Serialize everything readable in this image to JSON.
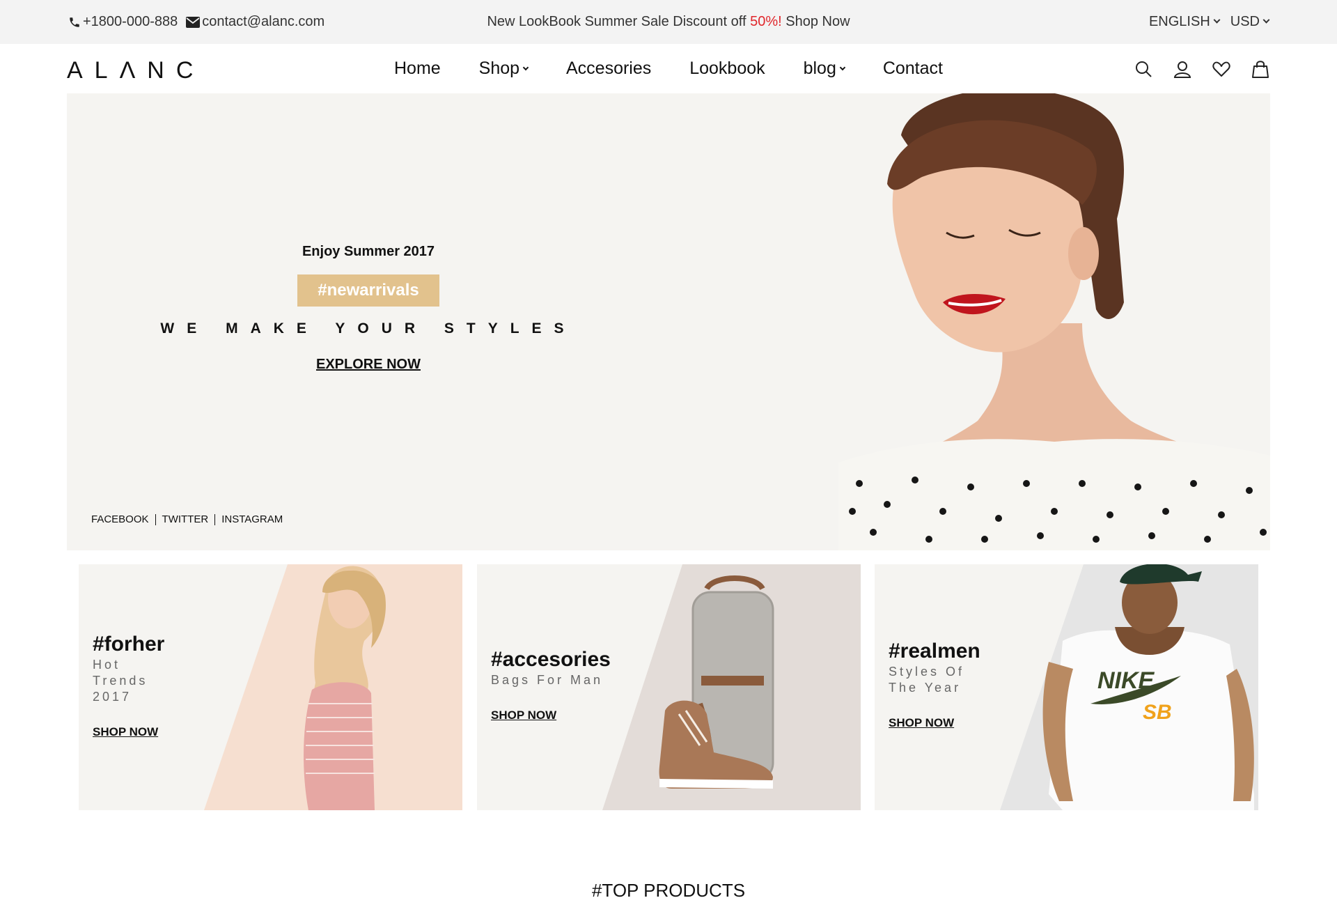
{
  "topbar": {
    "phone": "+1800-000-888",
    "email": "contact@alanc.com",
    "promo_prefix": "New LookBook Summer Sale Discount off",
    "promo_highlight": "50%!",
    "promo_link": "Shop Now",
    "language": "ENGLISH",
    "currency": "USD",
    "highlight_color": "#e0262b"
  },
  "header": {
    "logo": "ALΛNC",
    "nav": {
      "home": "Home",
      "shop": "Shop",
      "accesories": "Accesories",
      "lookbook": "Lookbook",
      "blog": "blog",
      "contact": "Contact"
    },
    "icons": [
      "search-icon",
      "account-icon",
      "wishlist-heart-icon",
      "cart-bag-icon"
    ]
  },
  "hero": {
    "eyebrow": "Enjoy Summer 2017",
    "tag": "#newarrivals",
    "slogan": "WE MAKE YOUR STYLES",
    "cta": "EXPLORE NOW",
    "social": [
      "FACEBOOK",
      "TWITTER",
      "INSTAGRAM"
    ],
    "tag_color": "#e2c28d",
    "background_color": "#f5f4f1"
  },
  "cards": [
    {
      "title": "#forher",
      "subtitle_lines": [
        "Hot",
        "Trends",
        "2017"
      ],
      "link": "SHOP NOW",
      "panel_color": "#f6dfd0"
    },
    {
      "title": "#accesories",
      "subtitle_lines": [
        "Bags For Man"
      ],
      "link": "SHOP NOW",
      "panel_color": "#e3dcd8"
    },
    {
      "title": "#realmen",
      "subtitle_lines": [
        "Styles Of",
        "The Year"
      ],
      "link": "SHOP NOW",
      "panel_color": "#e5e5e5"
    }
  ],
  "sections": {
    "top_products_title": "#TOP PRODUCTS"
  }
}
